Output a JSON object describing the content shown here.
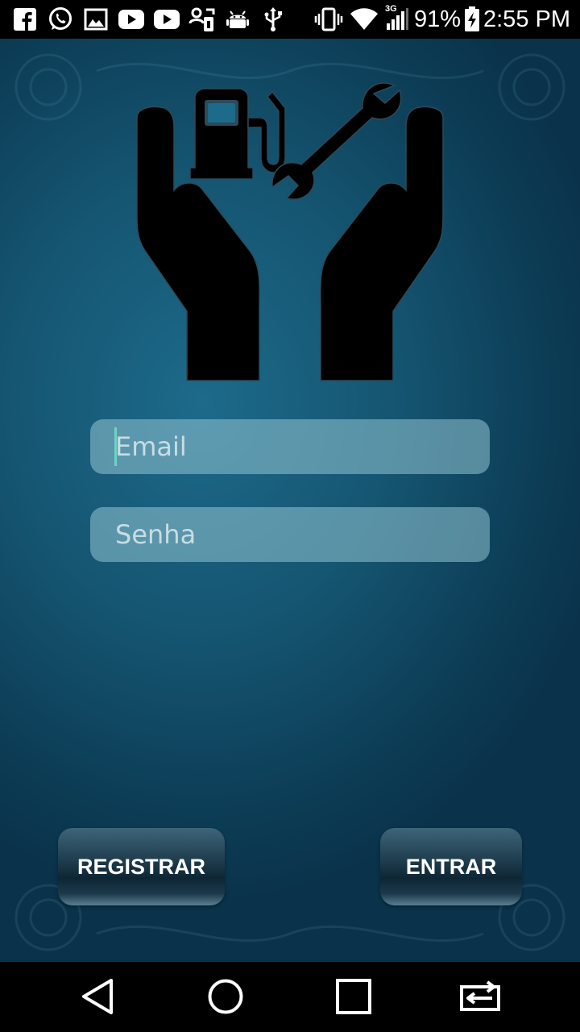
{
  "status_bar": {
    "notification_icons": [
      "facebook-icon",
      "whatsapp-icon",
      "gallery-icon",
      "youtube-icon",
      "youtube-icon",
      "contacts-sync-icon",
      "android-icon",
      "usb-icon"
    ],
    "vibrate_icon": "vibrate-icon",
    "wifi_icon": "wifi-icon",
    "network_type": "3G",
    "battery_percent": "91%",
    "time": "2:55 PM"
  },
  "login": {
    "logo_icon": "hands-fuel-wrench-logo",
    "email": {
      "value": "",
      "placeholder": "Email"
    },
    "password": {
      "value": "",
      "placeholder": "Senha"
    },
    "register_label": "REGISTRAR",
    "enter_label": "ENTRAR"
  },
  "nav_bar": {
    "back_icon": "back-triangle-icon",
    "home_icon": "home-circle-icon",
    "recents_icon": "recents-square-icon",
    "switch_icon": "switch-apps-icon"
  },
  "colors": {
    "background": "#155672",
    "field": "#94c4d2",
    "button": "#1c3a4b",
    "cursor": "#6fd2c7"
  }
}
